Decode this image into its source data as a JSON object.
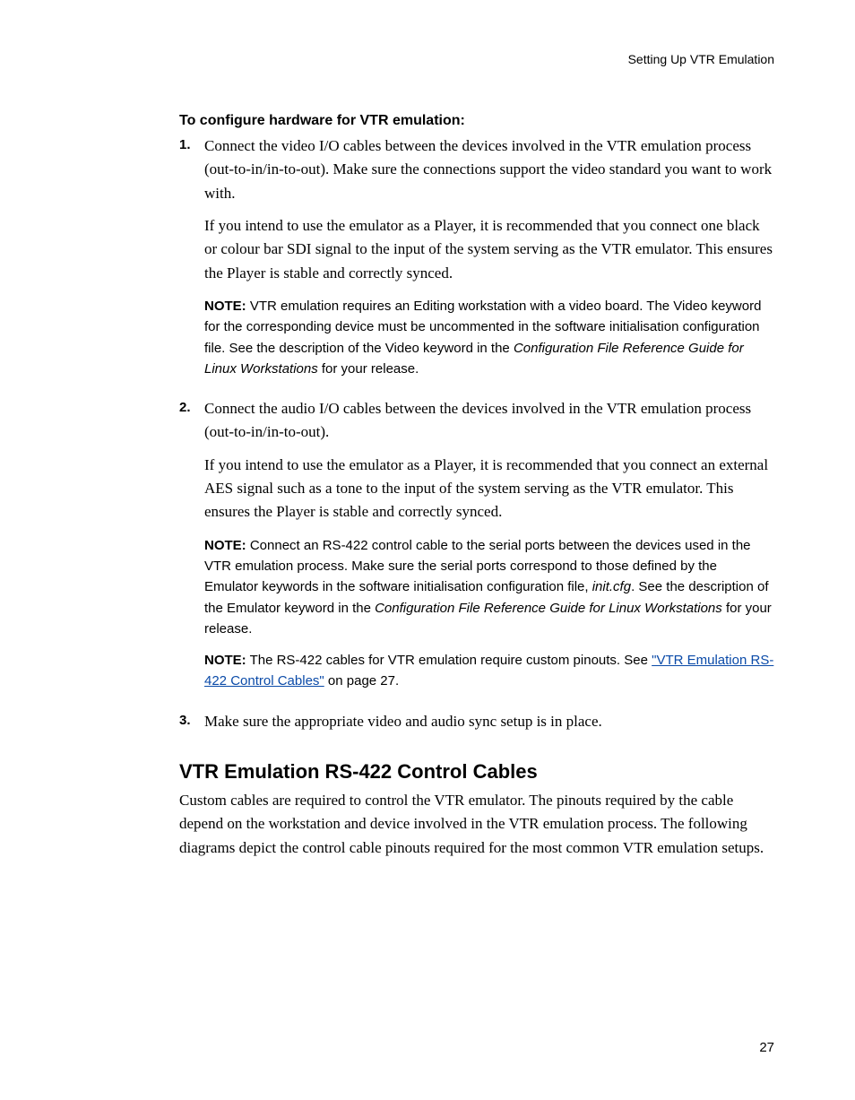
{
  "running_head": "Setting Up VTR Emulation",
  "section_lead": "To configure hardware for VTR emulation:",
  "steps": [
    {
      "para1": "Connect the video I/O cables between the devices involved in the VTR emulation process (out-to-in/in-to-out). Make sure the connections support the video standard you want to work with.",
      "para2": "If you intend to use the emulator as a Player, it is recommended that you connect one black or colour bar SDI signal to the input of the system serving as the VTR emulator. This ensures the Player is stable and correctly synced.",
      "note_label": "NOTE:",
      "note_before_italic": " VTR emulation requires an Editing workstation with a video board. The Video keyword for the corresponding device must be uncommented in the software initialisation configuration file. See the description of the Video keyword in the ",
      "note_italic": "Configuration File Reference Guide for Linux Workstations",
      "note_after_italic": " for your release."
    },
    {
      "para1": "Connect the audio I/O cables between the devices involved in the VTR emulation process (out-to-in/in-to-out).",
      "para2": "If you intend to use the emulator as a Player, it is recommended that you connect an external AES signal such as a tone to the input of the system serving as the VTR emulator. This ensures the Player is stable and correctly synced.",
      "note1_label": "NOTE:",
      "note1_before_italic1": " Connect an RS-422 control cable to the serial ports between the devices used in the VTR emulation process. Make sure the serial ports correspond to those defined by the Emulator keywords in the software initialisation configuration file, ",
      "note1_italic1": "init.cfg",
      "note1_mid": ". See the description of the Emulator keyword in the ",
      "note1_italic2": "Configuration File Reference Guide for Linux Workstations",
      "note1_after": " for your release.",
      "note2_label": "NOTE:",
      "note2_before_link": " The RS-422 cables for VTR emulation require custom pinouts. See ",
      "note2_link_text": "\"VTR Emulation RS-422 Control Cables\"",
      "note2_after_link": " on page 27."
    },
    {
      "para1": "Make sure the appropriate video and audio sync setup is in place."
    }
  ],
  "subhead": "VTR Emulation RS-422 Control Cables",
  "subhead_para": "Custom cables are required to control the VTR emulator. The pinouts required by the cable depend on the workstation and device involved in the VTR emulation process. The following diagrams depict the control cable pinouts required for the most common VTR emulation setups.",
  "page_number": "27"
}
